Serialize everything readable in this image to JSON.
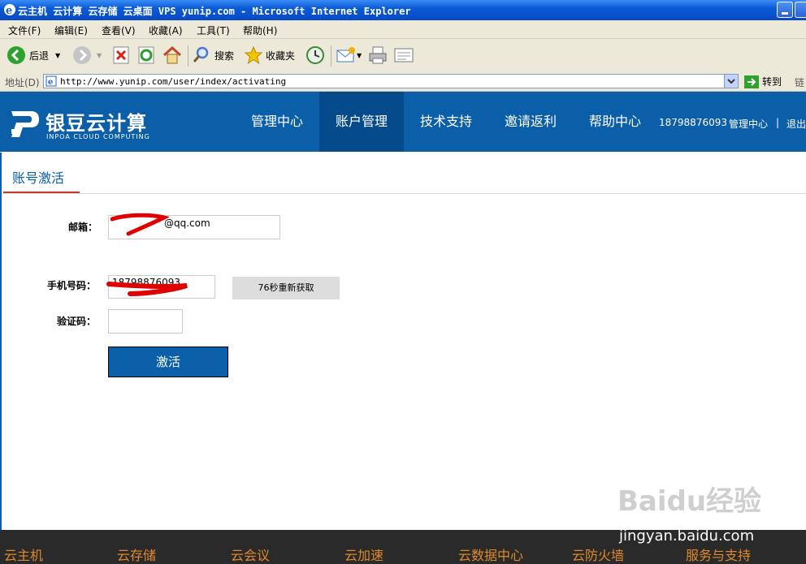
{
  "window": {
    "title": "云主机 云计算 云存储 云桌面 VPS yunip.com - Microsoft Internet Explorer"
  },
  "menu": [
    "文件(F)",
    "编辑(E)",
    "查看(V)",
    "收藏(A)",
    "工具(T)",
    "帮助(H)"
  ],
  "toolbar": {
    "back_label": "后退",
    "search_label": "搜索",
    "favorites_label": "收藏夹"
  },
  "address": {
    "label": "地址(D)",
    "url": "http://www.yunip.com/user/index/activating",
    "go_label": "转到",
    "links_label": "链"
  },
  "site": {
    "logo_cn": "银豆云计算",
    "logo_en": "INPOA CLOUD COMPUTING",
    "nav": [
      "管理中心",
      "账户管理",
      "技术支持",
      "邀请返利",
      "帮助中心"
    ],
    "user_phone": "18798876093",
    "user_center": "管理中心",
    "divider": "|",
    "logout": "退出"
  },
  "page": {
    "tab": "账号激活",
    "email_label": "邮箱：",
    "email_value": "@qq.com",
    "phone_label": "手机号码：",
    "phone_value": "18798876093",
    "resend_label": "76秒重新获取",
    "code_label": "验证码：",
    "code_value": "",
    "submit_label": "激活"
  },
  "footer": [
    "云主机",
    "云存储",
    "云会议",
    "云加速",
    "云数据中心",
    "云防火墙",
    "服务与支持"
  ],
  "watermark": {
    "main": "Baidu经验",
    "sub": "jingyan.baidu.com"
  },
  "colors": {
    "brand_blue": "#0b5ea8",
    "active_nav": "#054a8a",
    "footer_text": "#e0892a",
    "redaction": "#e00000"
  }
}
